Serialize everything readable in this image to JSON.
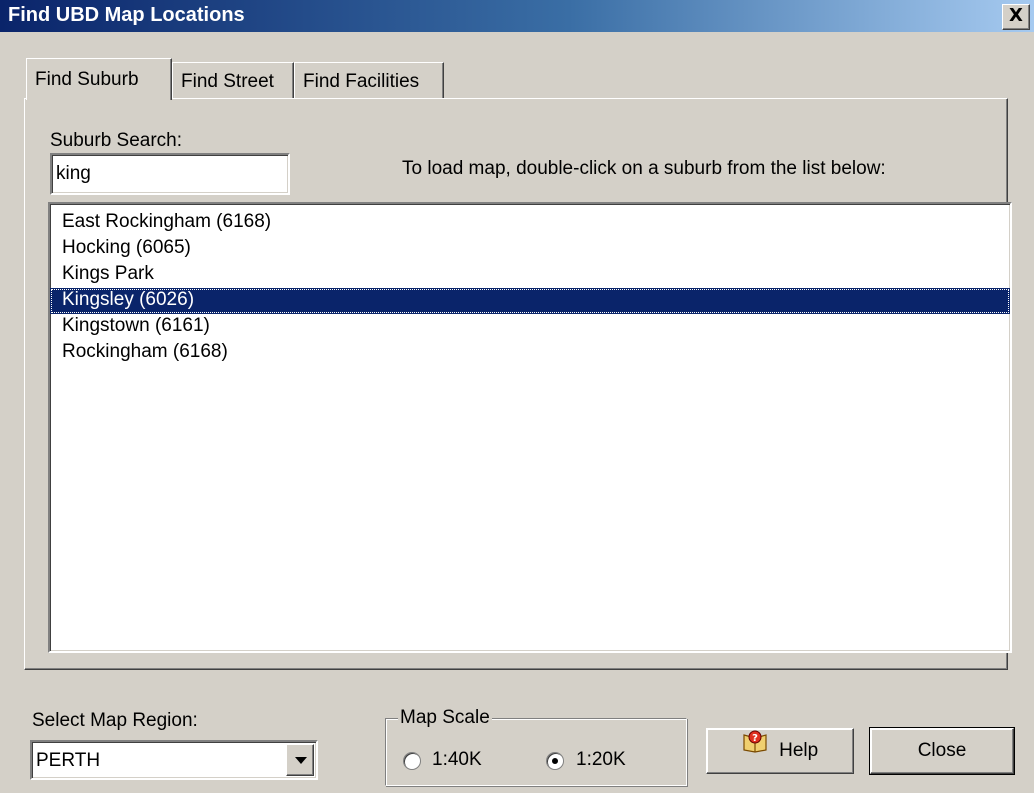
{
  "window": {
    "title": "Find UBD Map Locations",
    "close_glyph": "X"
  },
  "tabs": [
    {
      "label": "Find Suburb",
      "active": true
    },
    {
      "label": "Find Street",
      "active": false
    },
    {
      "label": "Find Facilities",
      "active": false
    }
  ],
  "suburb_search": {
    "label": "Suburb Search:",
    "value": "king",
    "instruction": "To load map, double-click on a suburb from the list below:"
  },
  "results": [
    {
      "label": "East Rockingham (6168)",
      "selected": false
    },
    {
      "label": "Hocking (6065)",
      "selected": false
    },
    {
      "label": "Kings Park",
      "selected": false
    },
    {
      "label": "Kingsley (6026)",
      "selected": true
    },
    {
      "label": "Kingstown (6161)",
      "selected": false
    },
    {
      "label": "Rockingham (6168)",
      "selected": false
    }
  ],
  "region": {
    "label": "Select Map Region:",
    "value": "PERTH"
  },
  "map_scale": {
    "legend": "Map Scale",
    "options": [
      {
        "label": "1:40K",
        "checked": false
      },
      {
        "label": "1:20K",
        "checked": true
      }
    ]
  },
  "buttons": {
    "help_label": "Help",
    "close_label": "Close"
  },
  "icons": {
    "help": "help-book-icon",
    "dropdown": "chevron-down-icon"
  },
  "colors": {
    "selection_bg": "#0a246a",
    "title_gradient_start": "#0a246a",
    "title_gradient_end": "#a6caf0",
    "dialog_bg": "#d4d0c8"
  }
}
